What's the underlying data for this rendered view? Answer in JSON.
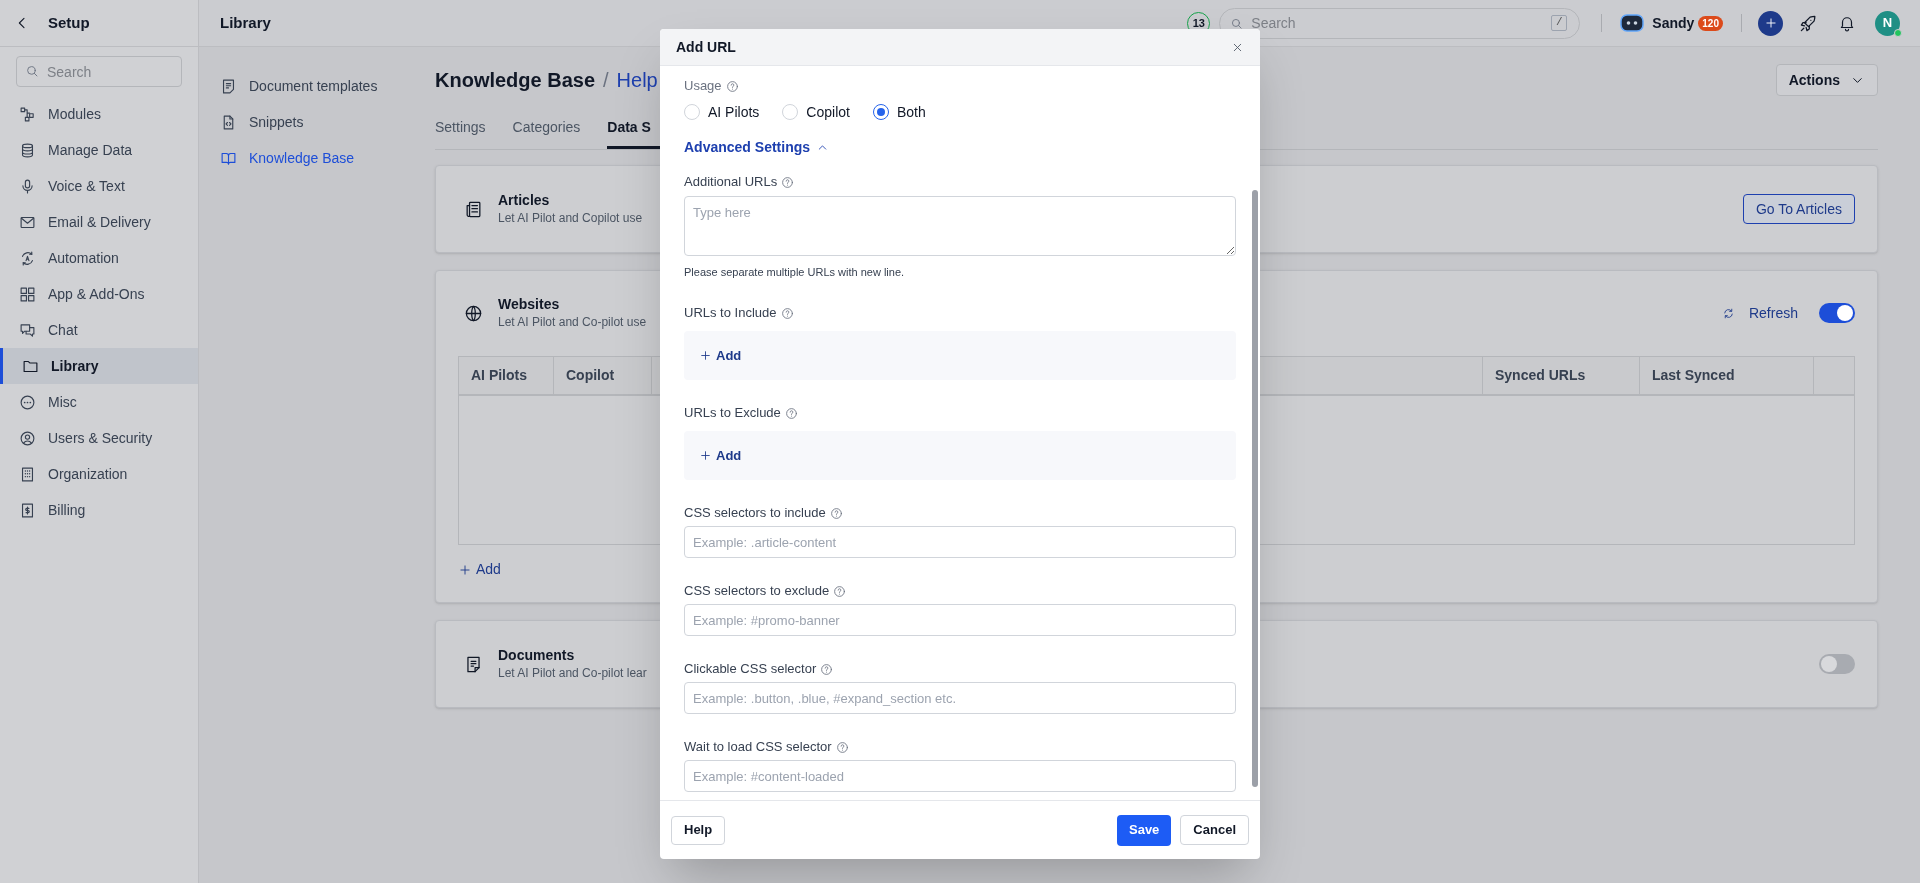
{
  "sidebar": {
    "title": "Setup",
    "search": {
      "placeholder": "Search"
    },
    "items": [
      {
        "label": "Modules",
        "selected": false
      },
      {
        "label": "Manage Data",
        "selected": false
      },
      {
        "label": "Voice & Text",
        "selected": false
      },
      {
        "label": "Email & Delivery",
        "selected": false
      },
      {
        "label": "Automation",
        "selected": false
      },
      {
        "label": "App & Add-Ons",
        "selected": false
      },
      {
        "label": "Chat",
        "selected": false
      },
      {
        "label": "Library",
        "selected": true
      },
      {
        "label": "Misc",
        "selected": false
      },
      {
        "label": "Users & Security",
        "selected": false
      },
      {
        "label": "Organization",
        "selected": false
      },
      {
        "label": "Billing",
        "selected": false
      }
    ]
  },
  "header": {
    "title": "Library",
    "counter": "13",
    "search": {
      "placeholder": "Search",
      "shortcut": "/"
    },
    "user": {
      "name": "Sandy",
      "badge": "120"
    },
    "avatar": "N"
  },
  "subnav": {
    "items": [
      {
        "label": "Document templates",
        "selected": false
      },
      {
        "label": "Snippets",
        "selected": false
      },
      {
        "label": "Knowledge Base",
        "selected": true
      }
    ]
  },
  "page": {
    "breadcrumb": {
      "root": "Knowledge Base",
      "separator": "/",
      "current": "Help"
    },
    "actions": "Actions",
    "tabs": [
      {
        "label": "Settings",
        "selected": false
      },
      {
        "label": "Categories",
        "selected": false
      },
      {
        "label": "Data S",
        "selected": true
      }
    ],
    "sections": [
      {
        "kind": "articles",
        "title": "Articles",
        "description": "Let AI Pilot and Copilot use",
        "button": "Go To Articles"
      },
      {
        "kind": "websites",
        "title": "Websites",
        "description": "Let AI Pilot and Co-pilot use",
        "refresh": "Refresh",
        "enabled": true,
        "columns": [
          "AI Pilots",
          "Copilot",
          "Synced URLs",
          "Last Synced"
        ],
        "add": "Add"
      },
      {
        "kind": "documents",
        "title": "Documents",
        "description": "Let AI Pilot and Co-pilot lear",
        "enabled": false
      }
    ]
  },
  "dialog": {
    "title": "Add URL",
    "usage": {
      "label": "Usage",
      "options": [
        {
          "label": "AI Pilots",
          "selected": false
        },
        {
          "label": "Copilot",
          "selected": false
        },
        {
          "label": "Both",
          "selected": true
        }
      ]
    },
    "advanced": {
      "label": "Advanced Settings",
      "expanded": true
    },
    "fields": [
      {
        "kind": "textarea",
        "label": "Additional URLs",
        "placeholder": "Type here",
        "hint": "Please separate multiple URLs with new line."
      },
      {
        "kind": "adder",
        "label": "URLs to Include",
        "add": "Add"
      },
      {
        "kind": "adder",
        "label": "URLs to Exclude",
        "add": "Add"
      },
      {
        "kind": "input",
        "label": "CSS selectors to include",
        "placeholder": "Example: .article-content"
      },
      {
        "kind": "input",
        "label": "CSS selectors to exclude",
        "placeholder": "Example: #promo-banner"
      },
      {
        "kind": "input",
        "label": "Clickable CSS selector",
        "placeholder": "Example: .button, .blue, #expand_section etc."
      },
      {
        "kind": "input",
        "label": "Wait to load CSS selector",
        "placeholder": "Example: #content-loaded"
      }
    ],
    "buttons": {
      "help": "Help",
      "save": "Save",
      "cancel": "Cancel"
    }
  }
}
